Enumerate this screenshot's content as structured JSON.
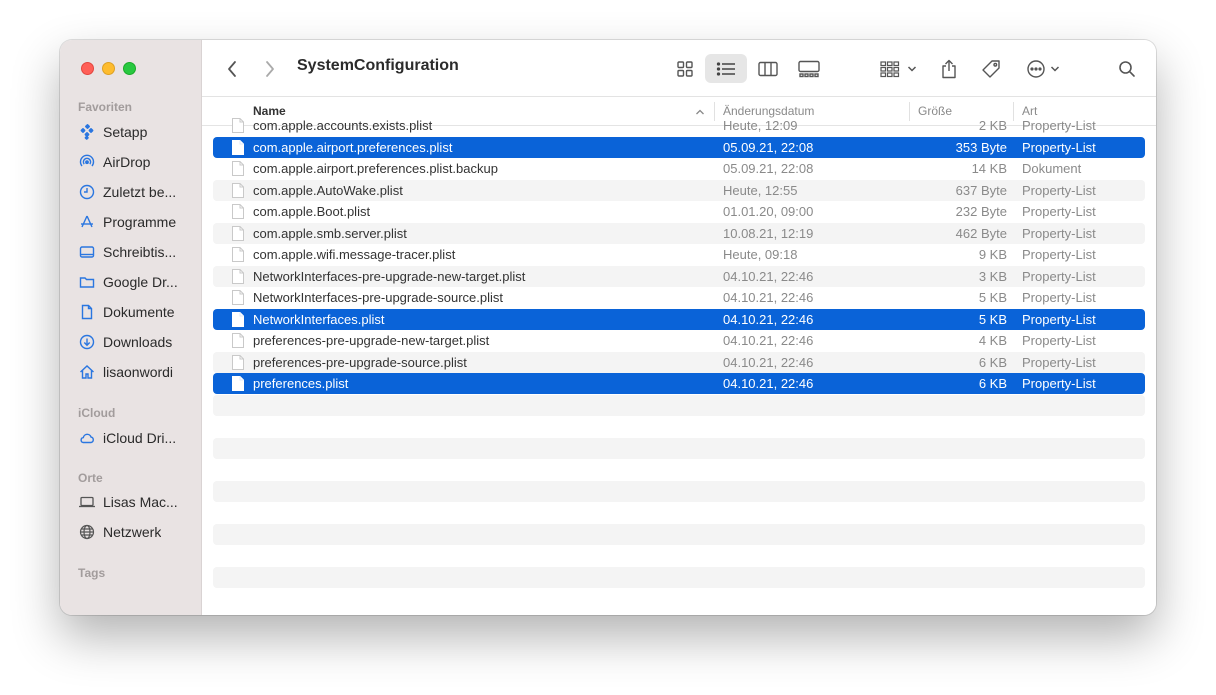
{
  "window": {
    "title": "SystemConfiguration"
  },
  "sidebar": {
    "sections": {
      "favorites": "Favoriten",
      "icloud": "iCloud",
      "places": "Orte",
      "tags": "Tags"
    },
    "favorites": [
      {
        "label": "Setapp",
        "icon": "setapp-icon"
      },
      {
        "label": "AirDrop",
        "icon": "airdrop-icon"
      },
      {
        "label": "Zuletzt be...",
        "icon": "clock-icon"
      },
      {
        "label": "Programme",
        "icon": "apps-icon"
      },
      {
        "label": "Schreibtis...",
        "icon": "desktop-icon"
      },
      {
        "label": "Google Dr...",
        "icon": "folder-icon"
      },
      {
        "label": "Dokumente",
        "icon": "document-icon"
      },
      {
        "label": "Downloads",
        "icon": "download-icon"
      },
      {
        "label": "lisaonwordi",
        "icon": "home-icon"
      }
    ],
    "icloud": [
      {
        "label": "iCloud Dri...",
        "icon": "cloud-icon"
      }
    ],
    "places": [
      {
        "label": "Lisas Mac...",
        "icon": "laptop-icon"
      },
      {
        "label": "Netzwerk",
        "icon": "globe-icon"
      }
    ]
  },
  "columns": {
    "name": "Name",
    "date": "Änderungsdatum",
    "size": "Größe",
    "kind": "Art"
  },
  "files": [
    {
      "name": "com.apple.accounts.exists.plist",
      "date": "Heute, 12:09",
      "size": "2 KB",
      "kind": "Property-List"
    },
    {
      "name": "com.apple.airport.preferences.plist",
      "date": "05.09.21, 22:08",
      "size": "353 Byte",
      "kind": "Property-List"
    },
    {
      "name": "com.apple.airport.preferences.plist.backup",
      "date": "05.09.21, 22:08",
      "size": "14 KB",
      "kind": "Dokument"
    },
    {
      "name": "com.apple.AutoWake.plist",
      "date": "Heute, 12:55",
      "size": "637 Byte",
      "kind": "Property-List"
    },
    {
      "name": "com.apple.Boot.plist",
      "date": "01.01.20, 09:00",
      "size": "232 Byte",
      "kind": "Property-List"
    },
    {
      "name": "com.apple.smb.server.plist",
      "date": "10.08.21, 12:19",
      "size": "462 Byte",
      "kind": "Property-List"
    },
    {
      "name": "com.apple.wifi.message-tracer.plist",
      "date": "Heute, 09:18",
      "size": "9 KB",
      "kind": "Property-List"
    },
    {
      "name": "NetworkInterfaces-pre-upgrade-new-target.plist",
      "date": "04.10.21, 22:46",
      "size": "3 KB",
      "kind": "Property-List"
    },
    {
      "name": "NetworkInterfaces-pre-upgrade-source.plist",
      "date": "04.10.21, 22:46",
      "size": "5 KB",
      "kind": "Property-List"
    },
    {
      "name": "NetworkInterfaces.plist",
      "date": "04.10.21, 22:46",
      "size": "5 KB",
      "kind": "Property-List"
    },
    {
      "name": "preferences-pre-upgrade-new-target.plist",
      "date": "04.10.21, 22:46",
      "size": "4 KB",
      "kind": "Property-List"
    },
    {
      "name": "preferences-pre-upgrade-source.plist",
      "date": "04.10.21, 22:46",
      "size": "6 KB",
      "kind": "Property-List"
    },
    {
      "name": "preferences.plist",
      "date": "04.10.21, 22:46",
      "size": "6 KB",
      "kind": "Property-List"
    }
  ],
  "selected": [
    1,
    9,
    12
  ],
  "colors": {
    "selection": "#0a63d8",
    "sidebar": "#e9e3e3",
    "accent": "#2a76e0"
  }
}
